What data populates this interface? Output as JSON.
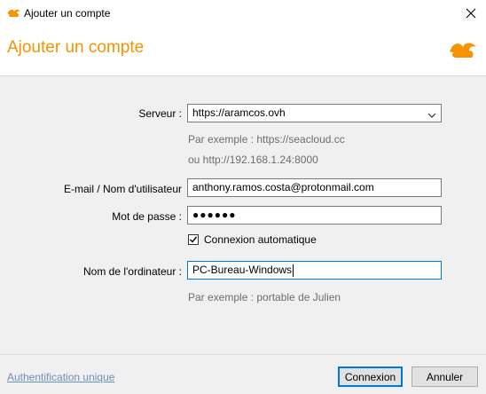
{
  "window": {
    "title": "Ajouter un compte",
    "close_icon": "close-icon"
  },
  "header": {
    "title": "Ajouter un compte",
    "logo_icon": "seafile-logo-icon",
    "accent_color": "#f59300"
  },
  "form": {
    "server": {
      "label": "Serveur :",
      "value": "https://aramcos.ovh",
      "hint_line1": "Par exemple : https://seacloud.cc",
      "hint_line2": "ou http://192.168.1.24:8000"
    },
    "email": {
      "label": "E-mail / Nom d'utilisateur",
      "value": "anthony.ramos.costa@protonmail.com"
    },
    "password": {
      "label": "Mot de passe :",
      "value": "●●●●●●"
    },
    "auto_login": {
      "label": "Connexion automatique",
      "checked": true
    },
    "computer_name": {
      "label": "Nom de l'ordinateur :",
      "value": "PC-Bureau-Windows",
      "hint": "Par exemple : portable de Julien"
    }
  },
  "footer": {
    "sso_link": "Authentification unique",
    "login_button": "Connexion",
    "cancel_button": "Annuler",
    "focus_color": "#0078d7"
  }
}
